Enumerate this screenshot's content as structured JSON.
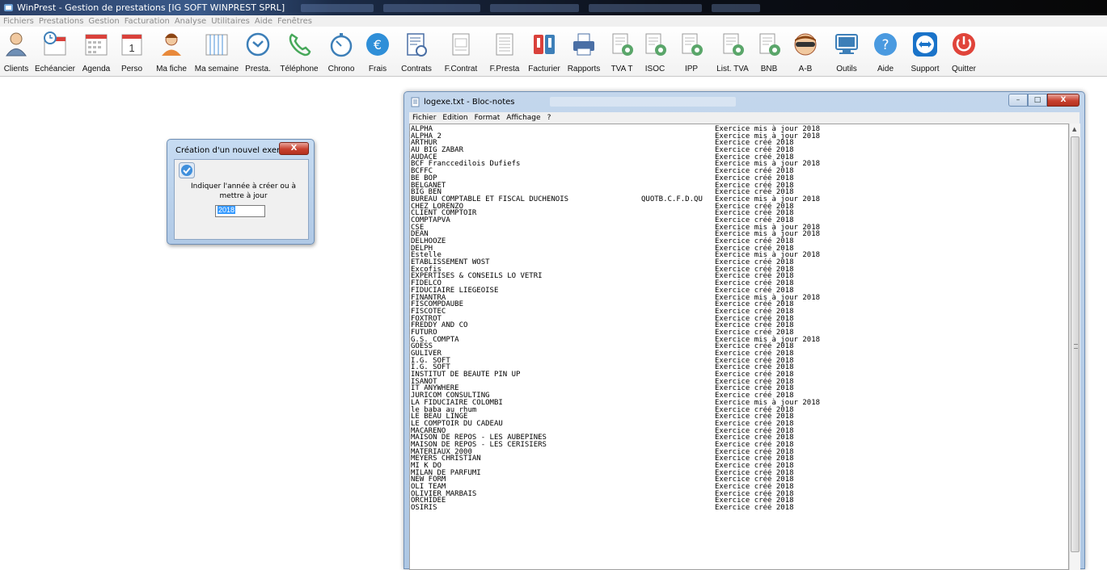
{
  "window": {
    "title": "WinPrest - Gestion de prestations [IG SOFT WINPREST SPRL]"
  },
  "menubar": [
    "Fichiers",
    "Prestations",
    "Gestion",
    "Facturation",
    "Analyse",
    "Utilitaires",
    "Aide",
    "Fenêtres"
  ],
  "toolbar": [
    {
      "label": "Clients",
      "icon": "user-icon",
      "color": "#8a6a4a"
    },
    {
      "label": "Echéancier",
      "icon": "clock-calendar-icon",
      "color": "#3d7fb8"
    },
    {
      "label": "Agenda",
      "icon": "calendar-grid-icon",
      "color": "#d9413b"
    },
    {
      "label": "Perso",
      "icon": "calendar-day-icon",
      "color": "#d9413b"
    },
    {
      "label": "Ma fiche",
      "icon": "person-orange-icon",
      "color": "#e8893a"
    },
    {
      "label": "Ma semaine",
      "icon": "week-grid-icon",
      "color": "#4a90d9"
    },
    {
      "label": "Presta.",
      "icon": "refresh-circle-icon",
      "color": "#3d7fb8"
    },
    {
      "label": "Téléphone",
      "icon": "phone-icon",
      "color": "#47a85a"
    },
    {
      "label": "Chrono",
      "icon": "stopwatch-icon",
      "color": "#3d7fb8"
    },
    {
      "label": "Frais",
      "icon": "euro-icon",
      "color": "#2f8fd8"
    },
    {
      "label": "Contrats",
      "icon": "contract-icon",
      "color": "#4a6fa5"
    },
    {
      "label": "F.Contrat",
      "icon": "document-icon",
      "color": "#888888"
    },
    {
      "label": "F.Presta",
      "icon": "document-lines-icon",
      "color": "#888888"
    },
    {
      "label": "Facturier",
      "icon": "invoice-book-icon",
      "color": "#d9413b"
    },
    {
      "label": "Rapports",
      "icon": "printer-icon",
      "color": "#4a6fa5"
    },
    {
      "label": "TVA T",
      "icon": "doc-green-badge-icon",
      "color": "#5aa66a"
    },
    {
      "label": "ISOC",
      "icon": "doc-green-badge-icon",
      "color": "#5aa66a"
    },
    {
      "label": "IPP",
      "icon": "doc-green-badge-icon",
      "color": "#5aa66a"
    },
    {
      "label": "List. TVA",
      "icon": "doc-green-badge-icon",
      "color": "#5aa66a"
    },
    {
      "label": "BNB",
      "icon": "doc-green-badge-icon",
      "color": "#5aa66a"
    },
    {
      "label": "A-B",
      "icon": "masked-face-icon",
      "color": "#e8893a"
    },
    {
      "label": "Outils",
      "icon": "monitor-icon",
      "color": "#3d7fb8"
    },
    {
      "label": "Aide",
      "icon": "help-icon",
      "color": "#4a9ae0"
    },
    {
      "label": "Support",
      "icon": "teamviewer-icon",
      "color": "#1a73c9"
    },
    {
      "label": "Quitter",
      "icon": "power-icon",
      "color": "#e0443a"
    }
  ],
  "dialog": {
    "title": "Création d'un nouvel exercice",
    "close_label": "X",
    "message": "Indiquer l'année à créer ou à mettre à jour",
    "input_value": "2018"
  },
  "notepad": {
    "title": "logexe.txt - Bloc-notes",
    "buttons": {
      "minimize": "–",
      "maximize": "□",
      "close": "X"
    },
    "menu": [
      "Fichier",
      "Edition",
      "Format",
      "Affichage",
      "?"
    ],
    "rows": [
      [
        "ALPHA",
        "",
        "Exercice mis à jour 2018"
      ],
      [
        "ALPHA 2",
        "",
        "Exercice mis à jour 2018"
      ],
      [
        "ARTHUR",
        "",
        "Exercice créé 2018"
      ],
      [
        "AU BIG ZABAR",
        "",
        "Exercice créé 2018"
      ],
      [
        "AUDACE",
        "",
        "Exercice créé 2018"
      ],
      [
        "BCF Franccedilois Dufiefs",
        "",
        "Exercice mis à jour 2018"
      ],
      [
        "BCFFC",
        "",
        "Exercice créé 2018"
      ],
      [
        "BE BOP",
        "",
        "Exercice créé 2018"
      ],
      [
        "BELGANET",
        "",
        "Exercice créé 2018"
      ],
      [
        "BIG BEN",
        "",
        "Exercice créé 2018"
      ],
      [
        "BUREAU COMPTABLE ET FISCAL DUCHENOIS",
        "QUOTB.C.F.D.QU",
        "Exercice mis à jour 2018"
      ],
      [
        "CHEZ LORENZO",
        "",
        "Exercice créé 2018"
      ],
      [
        "CLIENT COMPTOIR",
        "",
        "Exercice créé 2018"
      ],
      [
        "COMPTAPVA",
        "",
        "Exercice créé 2018"
      ],
      [
        "CSE",
        "",
        "Exercice mis à jour 2018"
      ],
      [
        "DEAN",
        "",
        "Exercice mis à jour 2018"
      ],
      [
        "DELHOOZE",
        "",
        "Exercice créé 2018"
      ],
      [
        "DELPH",
        "",
        "Exercice créé 2018"
      ],
      [
        "Estelle",
        "",
        "Exercice mis à jour 2018"
      ],
      [
        "ETABLISSEMENT WOST",
        "",
        "Exercice créé 2018"
      ],
      [
        "Excofis",
        "",
        "Exercice créé 2018"
      ],
      [
        "EXPERTISES & CONSEILS LO VETRI",
        "",
        "Exercice créé 2018"
      ],
      [
        "FIDELCO",
        "",
        "Exercice créé 2018"
      ],
      [
        "FIDUCIAIRE LIEGEOISE",
        "",
        "Exercice créé 2018"
      ],
      [
        "FINANTRA",
        "",
        "Exercice mis à jour 2018"
      ],
      [
        "FISCOMPDAUBE",
        "",
        "Exercice créé 2018"
      ],
      [
        "FISCOTEC",
        "",
        "Exercice créé 2018"
      ],
      [
        "FOXTROT",
        "",
        "Exercice créé 2018"
      ],
      [
        "FREDDY AND CO",
        "",
        "Exercice créé 2018"
      ],
      [
        "FUTURO",
        "",
        "Exercice créé 2018"
      ],
      [
        "G.S. COMPTA",
        "",
        "Exercice mis à jour 2018"
      ],
      [
        "GOESS",
        "",
        "Exercice créé 2018"
      ],
      [
        "GULIVER",
        "",
        "Exercice créé 2018"
      ],
      [
        "I.G. SOFT",
        "",
        "Exercice créé 2018"
      ],
      [
        "I.G. SOFT",
        "",
        "Exercice créé 2018"
      ],
      [
        "INSTITUT DE BEAUTE PIN UP",
        "",
        "Exercice créé 2018"
      ],
      [
        "ISANOT",
        "",
        "Exercice créé 2018"
      ],
      [
        "IT ANYWHERE",
        "",
        "Exercice créé 2018"
      ],
      [
        "JURICOM CONSULTING",
        "",
        "Exercice créé 2018"
      ],
      [
        "LA FIDUCIAIRE COLOMBI",
        "",
        "Exercice mis à jour 2018"
      ],
      [
        "le baba au rhum",
        "",
        "Exercice créé 2018"
      ],
      [
        "LE BEAU LINGE",
        "",
        "Exercice créé 2018"
      ],
      [
        "LE COMPTOIR DU CADEAU",
        "",
        "Exercice créé 2018"
      ],
      [
        "MACARENO",
        "",
        "Exercice créé 2018"
      ],
      [
        "MAISON DE REPOS - LES AUBEPINES",
        "",
        "Exercice créé 2018"
      ],
      [
        "MAISON DE REPOS - LES CERISIERS",
        "",
        "Exercice créé 2018"
      ],
      [
        "MATERIAUX 2000",
        "",
        "Exercice créé 2018"
      ],
      [
        "MEYERS CHRISTIAN",
        "",
        "Exercice créé 2018"
      ],
      [
        "MI K DO",
        "",
        "Exercice créé 2018"
      ],
      [
        "MILAN DE PARFUMI",
        "",
        "Exercice créé 2018"
      ],
      [
        "NEW FORM",
        "",
        "Exercice créé 2018"
      ],
      [
        "OLI TEAM",
        "",
        "Exercice créé 2018"
      ],
      [
        "OLIVIER MARBAIS",
        "",
        "Exercice créé 2018"
      ],
      [
        "ORCHIDEE",
        "",
        "Exercice créé 2018"
      ],
      [
        "OSIRIS",
        "",
        "Exercice créé 2018"
      ]
    ]
  }
}
